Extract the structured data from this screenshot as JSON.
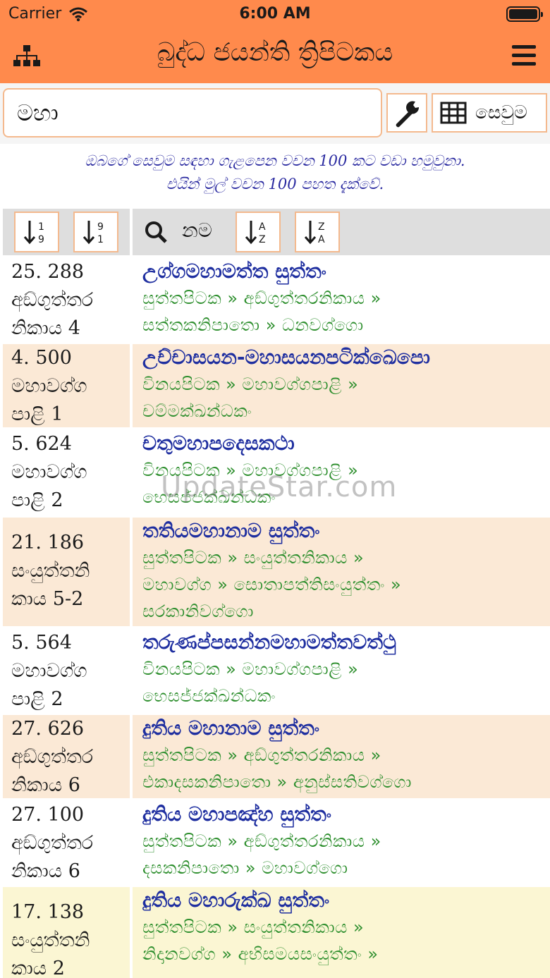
{
  "status": {
    "carrier": "Carrier",
    "time": "6:00 AM"
  },
  "app": {
    "title": "බුද්ධ ජයන්ති ත්‍රිපිටකය"
  },
  "search": {
    "value": "මහා",
    "button_label": "සෙවුම"
  },
  "notice": {
    "line1": "ඔබගේ සෙවුම සඳහා ගැළපෙන වචන 100 කට වඩා හමුවුනා.",
    "line2": "එයින් මුල් වචන 100 පහත දැක්වේ."
  },
  "table_header": {
    "name_label": "නම"
  },
  "rows": [
    {
      "ref": [
        "25. 288",
        "අඞ්ගුත්තර",
        "නිකාය 4"
      ],
      "title": "උග්ගමහාමත්ත සුත්තං",
      "path": [
        "සුත්තපිටක » අඞ්ගුත්තරනිකාය »",
        "සත්තකනිපාතො » ධනවග්ගො"
      ],
      "bg": "white"
    },
    {
      "ref": [
        "4. 500",
        "මහාවග්ග",
        "පාළි 1"
      ],
      "title": "උච්චාසයන-මහාසයනපටික්ඛෙපො",
      "path": [
        "විනයපිටක » මහාවග්ගපාළි »",
        "චම්මක්ඛන්ධකං"
      ],
      "bg": "peach"
    },
    {
      "ref": [
        "5. 624",
        "මහාවග්ග",
        "පාළි 2"
      ],
      "title": "චතුමහාපදෙසකථා",
      "path": [
        "විනයපිටක » මහාවග්ගපාළි »",
        "භෙසජ්ජක්ඛන්ධකං"
      ],
      "bg": "white"
    },
    {
      "ref": [
        "21. 186",
        "සංයුත්තනි",
        "කාය 5-2"
      ],
      "title": "තතියමහානාම සුත්තං",
      "path": [
        "සුත්තපිටක » සංයුත්තනිකාය »",
        "මහාවග්ග » සොතාපත්තිසංයුත්තං »",
        "සරකානිවග්ගො"
      ],
      "bg": "peach"
    },
    {
      "ref": [
        "5. 564",
        "මහාවග්ග",
        "පාළි 2"
      ],
      "title": "තරුණප්පසන්නමහාමත්තවත්ථු",
      "path": [
        "විනයපිටක » මහාවග්ගපාළි »",
        "භෙසජ්ජක්ඛන්ධකං"
      ],
      "bg": "white"
    },
    {
      "ref": [
        "27. 626",
        "අඞ්ගුත්තර",
        "නිකාය 6"
      ],
      "title": "දුතිය මහානාම සුත්තං",
      "path": [
        "සුත්තපිටක » අඞ්ගුත්තරනිකාය »",
        "එකාදසකනිපාතො » අනුස්සතිවග්ගො"
      ],
      "bg": "peach"
    },
    {
      "ref": [
        "27. 100",
        "අඞ්ගුත්තර",
        "නිකාය 6"
      ],
      "title": "දුතිය මහාපඤ්හ සුත්තං",
      "path": [
        "සුත්තපිටක » අඞ්ගුත්තරනිකාය »",
        "දසකනිපාතො » මහාවග්ගො"
      ],
      "bg": "white"
    },
    {
      "ref": [
        "17. 138",
        "සංයුත්තනි",
        "කාය 2"
      ],
      "title": "දුතිය මහාරුක්ඛ සුත්තං",
      "path": [
        "සුත්තපිටක » සංයුත්තනිකාය »",
        "නිදානවග්ග » අභිසමයසංයුත්තං »"
      ],
      "bg": "yellow"
    }
  ],
  "watermark": "UpdateStar.com"
}
